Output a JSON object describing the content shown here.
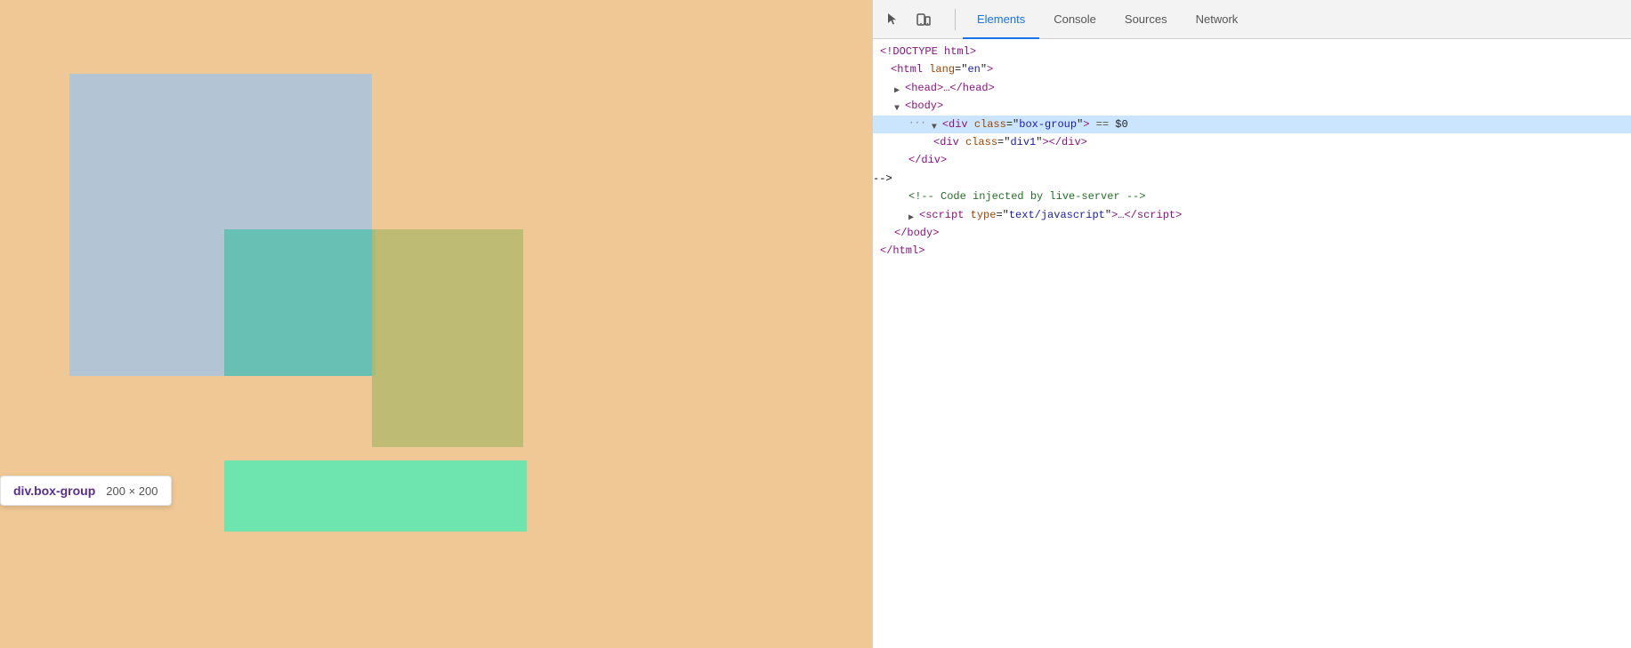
{
  "devtools": {
    "tabs": [
      {
        "id": "elements",
        "label": "Elements",
        "active": true
      },
      {
        "id": "console",
        "label": "Console",
        "active": false
      },
      {
        "id": "sources",
        "label": "Sources",
        "active": false
      },
      {
        "id": "network",
        "label": "Network",
        "active": false
      }
    ],
    "code_lines": [
      {
        "id": "doctype",
        "indent": 0,
        "triangle": "none",
        "text": "<!DOCTYPE html>",
        "selected": false
      },
      {
        "id": "html-open",
        "indent": 0,
        "triangle": "none",
        "text": "<html lang=\"en\">",
        "selected": false
      },
      {
        "id": "head",
        "indent": 1,
        "triangle": "closed",
        "text": "<head>…</head>",
        "selected": false
      },
      {
        "id": "body-open",
        "indent": 1,
        "triangle": "open",
        "text": "<body>",
        "selected": false
      },
      {
        "id": "div-box-group",
        "indent": 2,
        "triangle": "open",
        "text": "<div class=\"box-group\"> == $0",
        "selected": true,
        "has_dots": true
      },
      {
        "id": "div1",
        "indent": 3,
        "triangle": "none",
        "text": "<div class=\"div1\"></div>",
        "selected": false
      },
      {
        "id": "div-close",
        "indent": 2,
        "triangle": "none",
        "text": "</div>",
        "selected": false
      },
      {
        "id": "comment",
        "indent": 2,
        "triangle": "none",
        "text": "<!-- Code injected by live-server -->",
        "selected": false,
        "is_comment": true
      },
      {
        "id": "script",
        "indent": 2,
        "triangle": "closed",
        "text": "<script type=\"text/javascript\">…<\\/script>",
        "selected": false
      },
      {
        "id": "body-close",
        "indent": 1,
        "triangle": "none",
        "text": "</body>",
        "selected": false
      },
      {
        "id": "html-close",
        "indent": 0,
        "triangle": "none",
        "text": "</html>",
        "selected": false
      }
    ]
  },
  "tooltip": {
    "class": "div.box-group",
    "size": "200 × 200"
  },
  "icons": {
    "cursor": "⬡",
    "inspect": "⬢"
  }
}
